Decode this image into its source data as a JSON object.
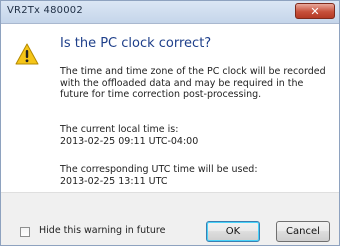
{
  "window": {
    "title": "VR2Tx 480002",
    "close_label": "✕"
  },
  "dialog": {
    "icon": "warning-icon",
    "heading": "Is the PC clock correct?",
    "body_lines": [
      "The time and time zone of the PC clock will be recorded",
      "with the offloaded data and may be required in the",
      "future for time correction post-processing."
    ],
    "local_time_label": "The current local time is:",
    "local_time_value": "2013-02-25 09:11 UTC-04:00",
    "utc_time_label": "The corresponding UTC time will be used:",
    "utc_time_value": "2013-02-25 13:11 UTC"
  },
  "footer": {
    "checkbox_label": "Hide this warning in future",
    "checkbox_checked": false,
    "ok_label": "OK",
    "cancel_label": "Cancel"
  },
  "colors": {
    "heading": "#1e3f8a",
    "close_button": "#c7503b",
    "warning_yellow": "#f5c518"
  }
}
